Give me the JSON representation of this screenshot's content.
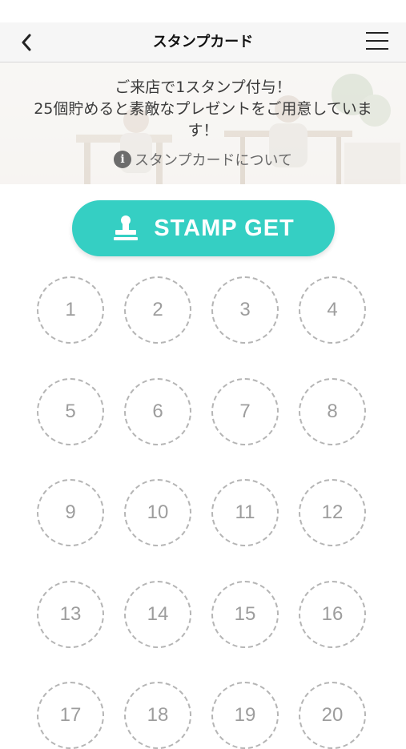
{
  "header": {
    "title": "スタンプカード",
    "back_icon": "chevron-left-icon",
    "menu_icon": "hamburger-menu-icon"
  },
  "banner": {
    "line1": "ご来店で1スタンプ付与！",
    "line2": "25個貯めると素敵なプレゼントをご用意していま",
    "line3": "す！",
    "link_label": "スタンプカードについて",
    "link_icon": "info-icon"
  },
  "stamp_button": {
    "label": "STAMP GET",
    "icon": "stamp-icon",
    "color": "#35cfc3"
  },
  "stamps": {
    "slots": [
      "1",
      "2",
      "3",
      "4",
      "5",
      "6",
      "7",
      "8",
      "9",
      "10",
      "11",
      "12",
      "13",
      "14",
      "15",
      "16",
      "17",
      "18",
      "19",
      "20"
    ]
  }
}
